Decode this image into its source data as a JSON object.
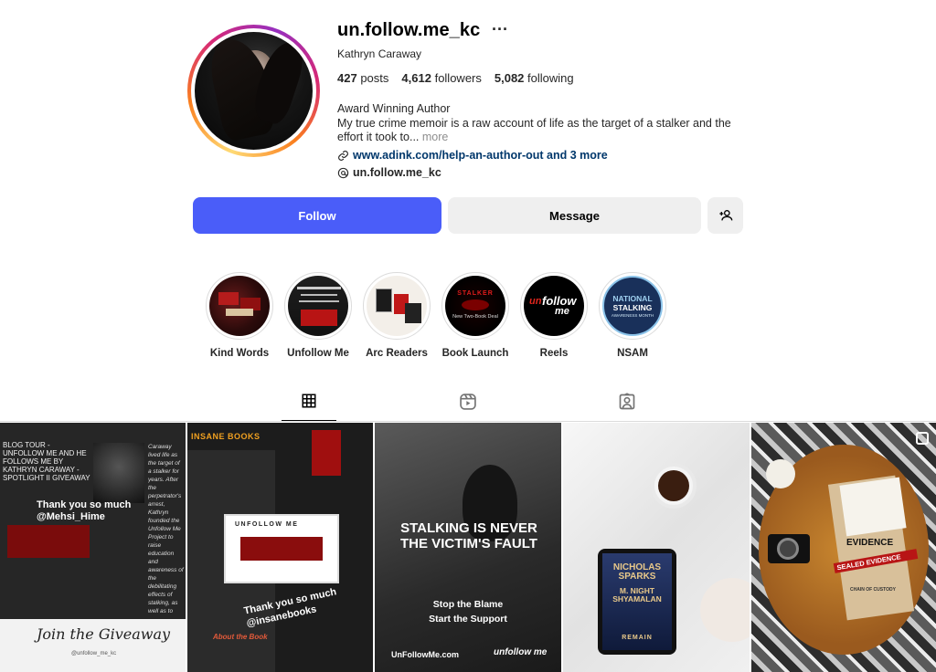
{
  "profile": {
    "username": "un.follow.me_kc",
    "more_icon": "···",
    "full_name": "Kathryn Caraway",
    "stats": {
      "posts": "427",
      "posts_label": "posts",
      "followers": "4,612",
      "followers_label": "followers",
      "following": "5,082",
      "following_label": "following"
    },
    "category": "Award Winning Author",
    "bio": "My true crime memoir is a raw account of life as the target of a stalker and the effort it took to...",
    "bio_more": "more",
    "link": "www.adink.com/help-an-author-out and 3 more",
    "threads": "un.follow.me_kc"
  },
  "actions": {
    "follow": "Follow",
    "message": "Message"
  },
  "highlights": [
    {
      "label": "Kind Words"
    },
    {
      "label": "Unfollow Me"
    },
    {
      "label": "Arc Readers"
    },
    {
      "label": "Book Launch"
    },
    {
      "label": "Reels"
    },
    {
      "label": "NSAM"
    }
  ],
  "highlight_text": {
    "stalker": "STALKER",
    "new_book": "New Two-Book Deal",
    "unfollow_a": "un",
    "unfollow_b": "follow",
    "unfollow_c": "me",
    "nsam_a": "NATIONAL",
    "nsam_b": "STALKING",
    "nsam_c": "AWARENESS MONTH"
  },
  "tabs": [
    {
      "icon": "grid-icon"
    },
    {
      "icon": "reels-icon"
    },
    {
      "icon": "tagged-icon"
    }
  ],
  "posts": {
    "p1": {
      "title": "BLOG TOUR - UNFOLLOW ME AND HE FOLLOWS ME BY KATHRYN CARAWAY - SPOTLIGHT II GIVEAWAY",
      "thanks": "Thank you so much @Mehsi_Hime",
      "side": "Caraway lived life as the target of a stalker for years. After the perpetrator's arrest, Kathryn founded the Unfollow Me Project to raise education and awareness of the debilitating effects of stalking, as well as to offer support to those being stalked. For more information, go to Unfollow Me.",
      "giveaway": "Join the Giveaway",
      "handle": "@unfollow_me_kc"
    },
    "p2": {
      "site": "INSANE BOOKS",
      "book_title": "UNFOLLOW ME",
      "thanks": "Thank you so much @insanebooks",
      "about": "About the Book"
    },
    "p3": {
      "headline": "STALKING IS NEVER THE VICTIM'S FAULT",
      "line1": "Stop the Blame",
      "line2": "Start the Support",
      "url": "UnFollowMe.com",
      "logo": "unfollow me"
    },
    "p4": {
      "author": "NICHOLAS SPARKS",
      "coauthor": "M. NIGHT SHYAMALAN",
      "book": "REMAIN"
    },
    "p5": {
      "evidence": "EVIDENCE",
      "sealed": "SEALED EVIDENCE",
      "chain": "CHAIN OF CUSTODY"
    }
  },
  "colors": {
    "follow": "#4a5df9",
    "link": "#00376b"
  }
}
